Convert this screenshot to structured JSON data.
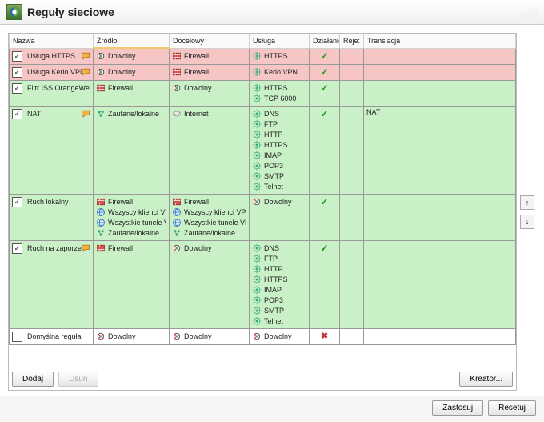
{
  "title": "Reguły sieciowe",
  "columns": {
    "name": "Nazwa",
    "source": "Źródło",
    "dest": "Docelowy",
    "service": "Usługa",
    "action": "Działanie",
    "reje": "Reje:",
    "trans": "Translacja"
  },
  "rows": [
    {
      "cls": "pink",
      "chk": true,
      "chat": true,
      "name": "Usługa HTTPS",
      "source": [
        {
          "t": "any",
          "label": "Dowolny"
        }
      ],
      "dest": [
        {
          "t": "fw",
          "label": "Firewall"
        }
      ],
      "service": [
        {
          "t": "svc",
          "label": "HTTPS"
        }
      ],
      "action": "allow",
      "trans": ""
    },
    {
      "cls": "pink",
      "chk": true,
      "chat": true,
      "name": "Usługa Kerio VPN",
      "source": [
        {
          "t": "any",
          "label": "Dowolny"
        }
      ],
      "dest": [
        {
          "t": "fw",
          "label": "Firewall"
        }
      ],
      "service": [
        {
          "t": "svc",
          "label": "Kerio VPN"
        }
      ],
      "action": "allow",
      "trans": ""
    },
    {
      "cls": "green",
      "chk": true,
      "chat": false,
      "name": "Filtr ISS OrangeWeb Filter",
      "source": [
        {
          "t": "fw",
          "label": "Firewall"
        }
      ],
      "dest": [
        {
          "t": "any",
          "label": "Dowolny"
        }
      ],
      "service": [
        {
          "t": "svc",
          "label": "HTTPS"
        },
        {
          "t": "svc",
          "label": "TCP 6000"
        }
      ],
      "action": "allow",
      "trans": ""
    },
    {
      "cls": "green",
      "chk": true,
      "chat": true,
      "name": "NAT",
      "source": [
        {
          "t": "trust",
          "label": "Zaufane/lokalne"
        }
      ],
      "dest": [
        {
          "t": "net",
          "label": "Internet"
        }
      ],
      "service": [
        {
          "t": "svc",
          "label": "DNS"
        },
        {
          "t": "svc",
          "label": "FTP"
        },
        {
          "t": "svc",
          "label": "HTTP"
        },
        {
          "t": "svc",
          "label": "HTTPS"
        },
        {
          "t": "svc",
          "label": "IMAP"
        },
        {
          "t": "svc",
          "label": "POP3"
        },
        {
          "t": "svc",
          "label": "SMTP"
        },
        {
          "t": "svc",
          "label": "Telnet"
        }
      ],
      "action": "allow",
      "trans": "NAT"
    },
    {
      "cls": "green",
      "chk": true,
      "chat": false,
      "name": "Ruch lokalny",
      "source": [
        {
          "t": "fw",
          "label": "Firewall"
        },
        {
          "t": "globe",
          "label": "Wszyscy klienci VPN"
        },
        {
          "t": "globe",
          "label": "Wszystkie tunele VPN"
        },
        {
          "t": "trust",
          "label": "Zaufane/lokalne"
        }
      ],
      "dest": [
        {
          "t": "fw",
          "label": "Firewall"
        },
        {
          "t": "globe",
          "label": "Wszyscy klienci VPN"
        },
        {
          "t": "globe",
          "label": "Wszystkie tunele VPN"
        },
        {
          "t": "trust",
          "label": "Zaufane/lokalne"
        }
      ],
      "service": [
        {
          "t": "any",
          "label": "Dowolny"
        }
      ],
      "action": "allow",
      "trans": ""
    },
    {
      "cls": "green",
      "chk": true,
      "chat": true,
      "name": "Ruch na zaporze",
      "source": [
        {
          "t": "fw",
          "label": "Firewall"
        }
      ],
      "dest": [
        {
          "t": "any",
          "label": "Dowolny"
        }
      ],
      "service": [
        {
          "t": "svc",
          "label": "DNS"
        },
        {
          "t": "svc",
          "label": "FTP"
        },
        {
          "t": "svc",
          "label": "HTTP"
        },
        {
          "t": "svc",
          "label": "HTTPS"
        },
        {
          "t": "svc",
          "label": "IMAP"
        },
        {
          "t": "svc",
          "label": "POP3"
        },
        {
          "t": "svc",
          "label": "SMTP"
        },
        {
          "t": "svc",
          "label": "Telnet"
        }
      ],
      "action": "allow",
      "trans": ""
    },
    {
      "cls": "white",
      "chk": false,
      "chat": false,
      "name": "Domyślna reguła",
      "source": [
        {
          "t": "any",
          "label": "Dowolny"
        }
      ],
      "dest": [
        {
          "t": "any",
          "label": "Dowolny"
        }
      ],
      "service": [
        {
          "t": "any",
          "label": "Dowolny"
        }
      ],
      "action": "deny",
      "trans": ""
    }
  ],
  "buttons": {
    "add": "Dodaj",
    "remove": "Usuń",
    "wizard": "Kreator...",
    "apply": "Zastosuj",
    "reset": "Resetuj"
  }
}
